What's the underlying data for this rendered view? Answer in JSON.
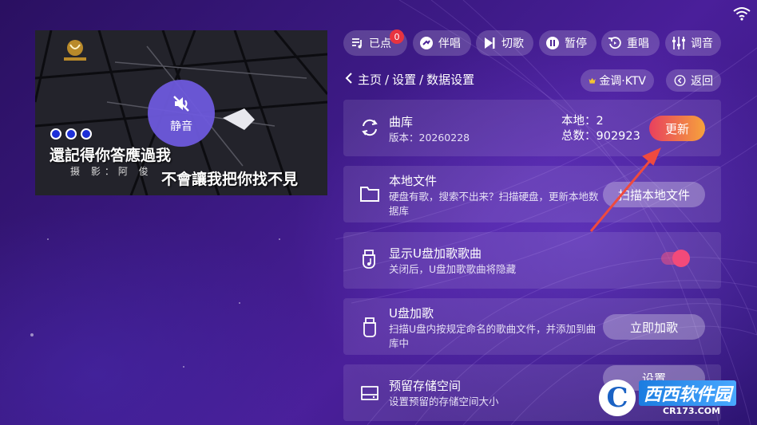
{
  "colors": {
    "background": "#3d1a86",
    "accent_gradient_start": "#e8405e",
    "accent_gradient_end": "#f6a23c",
    "badge": "#e8333f",
    "toggle": "#f24a7a",
    "crown": "#f5c531"
  },
  "status_bar": {
    "icon": "wifi-icon"
  },
  "video": {
    "mute_label": "静音",
    "lyric_line1": "還記得你答應過我",
    "credit": "摄 影：阿 俊",
    "lyric_line2": "不會讓我把你找不見"
  },
  "controls": {
    "ordered_label": "已点",
    "ordered_count": "0",
    "vocal_label": "伴唱",
    "skip_label": "切歌",
    "pause_label": "暂停",
    "replay_label": "重唱",
    "tune_label": "调音"
  },
  "breadcrumb": {
    "home": "主页",
    "sep1": "/",
    "settings": "设置",
    "sep2": "/",
    "current": "数据设置"
  },
  "brand_pill": {
    "label": "金调·KTV",
    "icon": "crown-icon"
  },
  "back_button": {
    "label": "返回",
    "icon": "back-circle-icon"
  },
  "library": {
    "title": "曲库",
    "version": "版本：20260228",
    "local_label": "本地：",
    "local_count": "2",
    "total_label": "总数：",
    "total_count": "902923",
    "update_label": "更新",
    "icon": "sync-icon"
  },
  "local_files": {
    "title": "本地文件",
    "desc": "硬盘有歌，搜索不出来？扫描硬盘，更新本地数据库",
    "button_label": "扫描本地文件",
    "icon": "folder-icon"
  },
  "usb_display": {
    "title": "显示U盘加歌歌曲",
    "desc": "关闭后，U盘加歌歌曲将隐藏",
    "toggle_on": true,
    "icon": "usb-music-icon"
  },
  "usb_add": {
    "title": "U盘加歌",
    "desc": "扫描U盘内按规定命名的歌曲文件，并添加到曲库中",
    "button_label": "立即加歌",
    "icon": "usb-icon"
  },
  "storage": {
    "title": "预留存储空间",
    "desc": "设置预留的存储空间大小",
    "button_label": "设置",
    "icon": "drive-icon"
  },
  "watermark": {
    "brand": "西西软件园",
    "domain": "CR173.COM"
  }
}
